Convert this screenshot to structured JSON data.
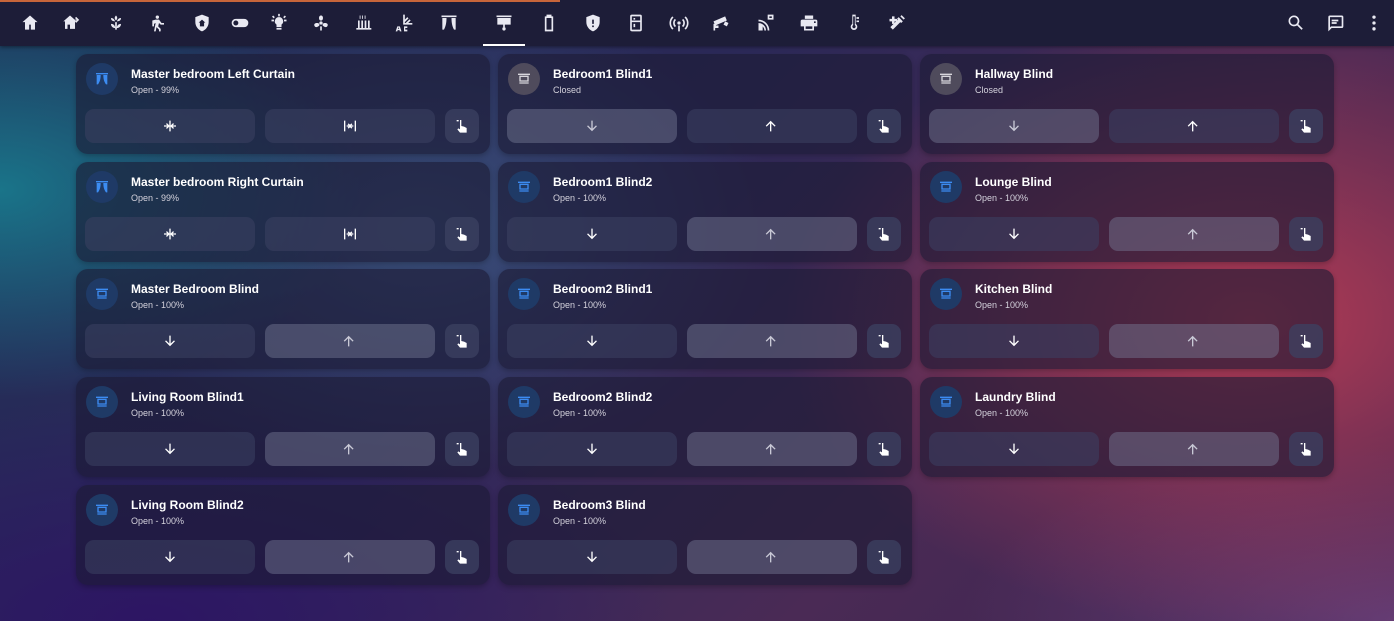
{
  "toolbar": {
    "tabs": [
      {
        "icon": "home-icon",
        "active": false
      },
      {
        "icon": "home-export-icon",
        "active": false
      },
      {
        "icon": "flower-icon",
        "active": false
      },
      {
        "icon": "motion-sensor-icon",
        "active": false
      },
      {
        "icon": "shield-home-icon",
        "active": false
      },
      {
        "icon": "toggle-switch-icon",
        "active": false
      },
      {
        "icon": "lightbulb-icon",
        "active": false
      },
      {
        "icon": "fan-speed-icon",
        "active": false
      },
      {
        "icon": "radiator-icon",
        "active": false
      },
      {
        "icon": "air-conditioner-icon",
        "active": false
      },
      {
        "icon": "curtains-icon",
        "active": false
      },
      {
        "icon": "blinds-icon",
        "active": true
      },
      {
        "icon": "battery-icon",
        "active": false
      },
      {
        "icon": "shield-alert-icon",
        "active": false
      },
      {
        "icon": "fridge-icon",
        "active": false
      },
      {
        "icon": "access-point-icon",
        "active": false
      },
      {
        "icon": "cctv-icon",
        "active": false
      },
      {
        "icon": "network-icon",
        "active": false
      },
      {
        "icon": "printer-icon",
        "active": false
      },
      {
        "icon": "thermometer-icon",
        "active": false
      },
      {
        "icon": "tools-icon",
        "active": false
      }
    ],
    "right_icons": [
      "search-icon",
      "assist-icon",
      "overflow-menu-icon"
    ]
  },
  "cards": [
    {
      "name": "Master bedroom Left Curtain",
      "state": "Open - 99%",
      "type": "curtain",
      "closed": false,
      "btn1_icon": "curtain-close-icon",
      "btn2_icon": "curtain-open-icon",
      "btn1_dim": false,
      "btn2_dim": false
    },
    {
      "name": "Master bedroom Right Curtain",
      "state": "Open - 99%",
      "type": "curtain",
      "closed": false,
      "btn1_icon": "curtain-close-icon",
      "btn2_icon": "curtain-open-icon",
      "btn1_dim": false,
      "btn2_dim": false
    },
    {
      "name": "Master Bedroom Blind",
      "state": "Open - 100%",
      "type": "blind",
      "closed": false,
      "btn1_icon": "arrow-down-icon",
      "btn2_icon": "arrow-up-icon",
      "btn1_dim": false,
      "btn2_dim": true
    },
    {
      "name": "Living Room Blind1",
      "state": "Open - 100%",
      "type": "blind",
      "closed": false,
      "btn1_icon": "arrow-down-icon",
      "btn2_icon": "arrow-up-icon",
      "btn1_dim": false,
      "btn2_dim": true
    },
    {
      "name": "Living Room Blind2",
      "state": "Open - 100%",
      "type": "blind",
      "closed": false,
      "btn1_icon": "arrow-down-icon",
      "btn2_icon": "arrow-up-icon",
      "btn1_dim": false,
      "btn2_dim": true
    },
    {
      "name": "Bedroom1 Blind1",
      "state": "Closed",
      "type": "blind",
      "closed": true,
      "btn1_icon": "arrow-down-icon",
      "btn2_icon": "arrow-up-icon",
      "btn1_dim": true,
      "btn2_dim": false
    },
    {
      "name": "Bedroom1 Blind2",
      "state": "Open - 100%",
      "type": "blind",
      "closed": false,
      "btn1_icon": "arrow-down-icon",
      "btn2_icon": "arrow-up-icon",
      "btn1_dim": false,
      "btn2_dim": true
    },
    {
      "name": "Bedroom2 Blind1",
      "state": "Open - 100%",
      "type": "blind",
      "closed": false,
      "btn1_icon": "arrow-down-icon",
      "btn2_icon": "arrow-up-icon",
      "btn1_dim": false,
      "btn2_dim": true
    },
    {
      "name": "Bedroom2 Blind2",
      "state": "Open - 100%",
      "type": "blind",
      "closed": false,
      "btn1_icon": "arrow-down-icon",
      "btn2_icon": "arrow-up-icon",
      "btn1_dim": false,
      "btn2_dim": true
    },
    {
      "name": "Bedroom3 Blind",
      "state": "Open - 100%",
      "type": "blind",
      "closed": false,
      "btn1_icon": "arrow-down-icon",
      "btn2_icon": "arrow-up-icon",
      "btn1_dim": false,
      "btn2_dim": true
    },
    {
      "name": "Hallway Blind",
      "state": "Closed",
      "type": "blind",
      "closed": true,
      "btn1_icon": "arrow-down-icon",
      "btn2_icon": "arrow-up-icon",
      "btn1_dim": true,
      "btn2_dim": false
    },
    {
      "name": "Lounge Blind",
      "state": "Open - 100%",
      "type": "blind",
      "closed": false,
      "btn1_icon": "arrow-down-icon",
      "btn2_icon": "arrow-up-icon",
      "btn1_dim": false,
      "btn2_dim": true
    },
    {
      "name": "Kitchen Blind",
      "state": "Open - 100%",
      "type": "blind",
      "closed": false,
      "btn1_icon": "arrow-down-icon",
      "btn2_icon": "arrow-up-icon",
      "btn1_dim": false,
      "btn2_dim": true
    },
    {
      "name": "Laundry Blind",
      "state": "Open - 100%",
      "type": "blind",
      "closed": false,
      "btn1_icon": "arrow-down-icon",
      "btn2_icon": "arrow-up-icon",
      "btn1_dim": false,
      "btn2_dim": true
    }
  ],
  "colors": {
    "accent_blue": "#3c8cf2",
    "closed_icon": "#d8d6dc",
    "toolbar_bg": "#1d1d38"
  }
}
